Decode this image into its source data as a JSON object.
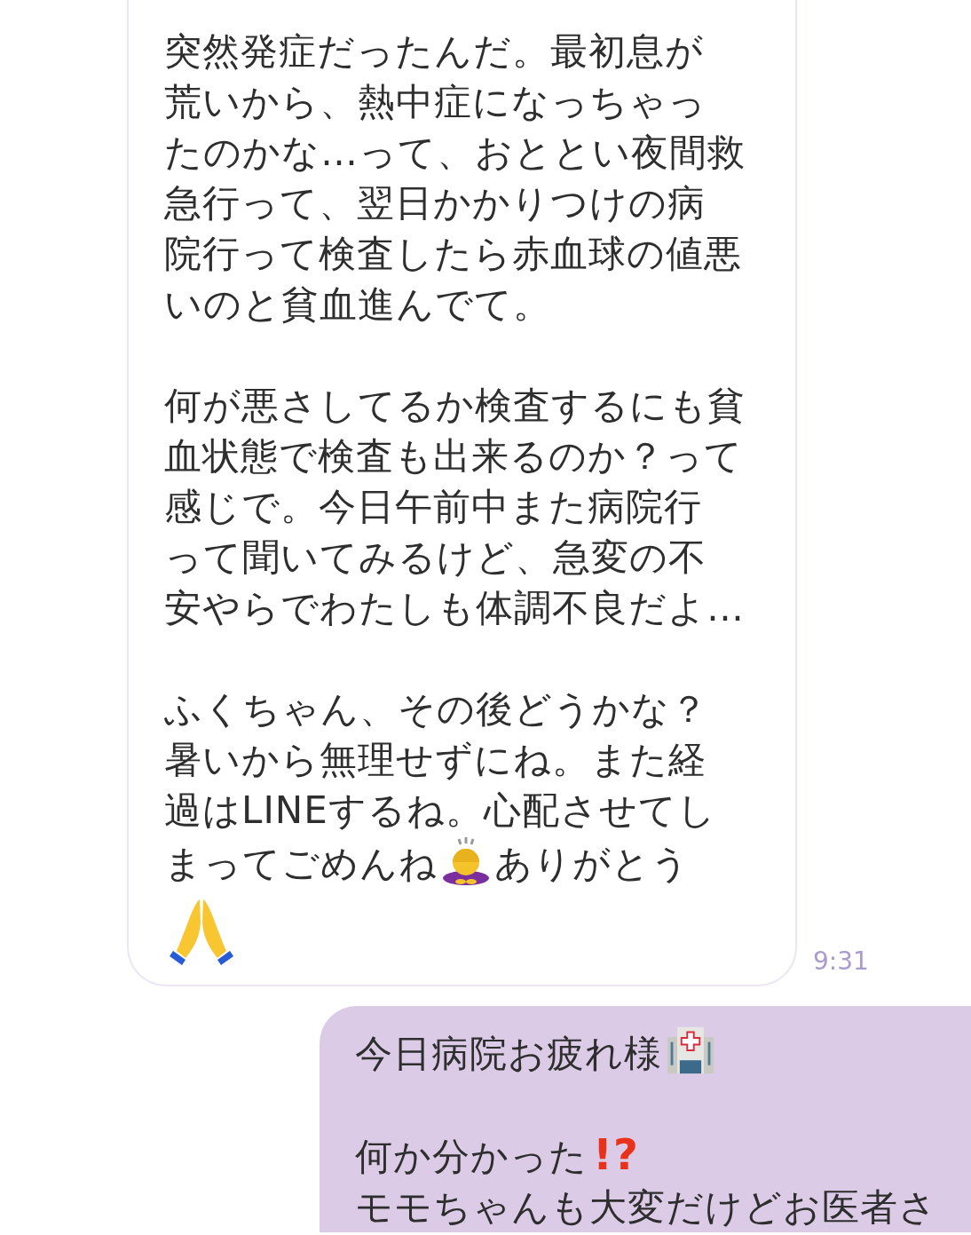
{
  "messages": [
    {
      "kind": "received",
      "time": "9:31",
      "paragraphs": [
        [
          [
            {
              "kind": "text",
              "text": "突然発症だったんだ。最初息が"
            }
          ],
          [
            {
              "kind": "text",
              "text": "荒いから、熱中症になっちゃっ"
            }
          ],
          [
            {
              "kind": "text",
              "text": "たのかな…って、おととい夜間救"
            }
          ],
          [
            {
              "kind": "text",
              "text": "急行って、翌日かかりつけの病"
            }
          ],
          [
            {
              "kind": "text",
              "text": "院行って検査したら赤血球の値悪"
            }
          ],
          [
            {
              "kind": "text",
              "text": "いのと貧血進んでて。"
            }
          ]
        ],
        [
          [
            {
              "kind": "text",
              "text": "何が悪さしてるか検査するにも貧"
            }
          ],
          [
            {
              "kind": "text",
              "text": "血状態で検査も出来るのか？って"
            }
          ],
          [
            {
              "kind": "text",
              "text": "感じで。今日午前中また病院行"
            }
          ],
          [
            {
              "kind": "text",
              "text": "って聞いてみるけど、急変の不"
            }
          ],
          [
            {
              "kind": "text",
              "text": "安やらでわたしも体調不良だよ…"
            }
          ]
        ],
        [
          [
            {
              "kind": "text",
              "text": "ふくちゃん、その後どうかな？"
            }
          ],
          [
            {
              "kind": "text",
              "text": "暑いから無理せずにね。また経"
            }
          ],
          [
            {
              "kind": "text",
              "text": "過はLINEするね。心配させてし"
            }
          ],
          [
            {
              "kind": "text",
              "text": "まってごめんね"
            },
            {
              "kind": "bowing"
            },
            {
              "kind": "text",
              "text": "ありがとう"
            }
          ],
          [
            {
              "kind": "pray"
            }
          ]
        ]
      ]
    },
    {
      "kind": "sent",
      "paragraphs": [
        [
          [
            {
              "kind": "text",
              "text": "今日病院お疲れ様"
            },
            {
              "kind": "hospital"
            }
          ]
        ],
        [
          [
            {
              "kind": "text",
              "text": "何か分かった"
            },
            {
              "kind": "mark",
              "text": "!?"
            }
          ],
          [
            {
              "kind": "text",
              "text": "モモちゃんも大変だけどお医者さ"
            }
          ]
        ]
      ]
    }
  ]
}
